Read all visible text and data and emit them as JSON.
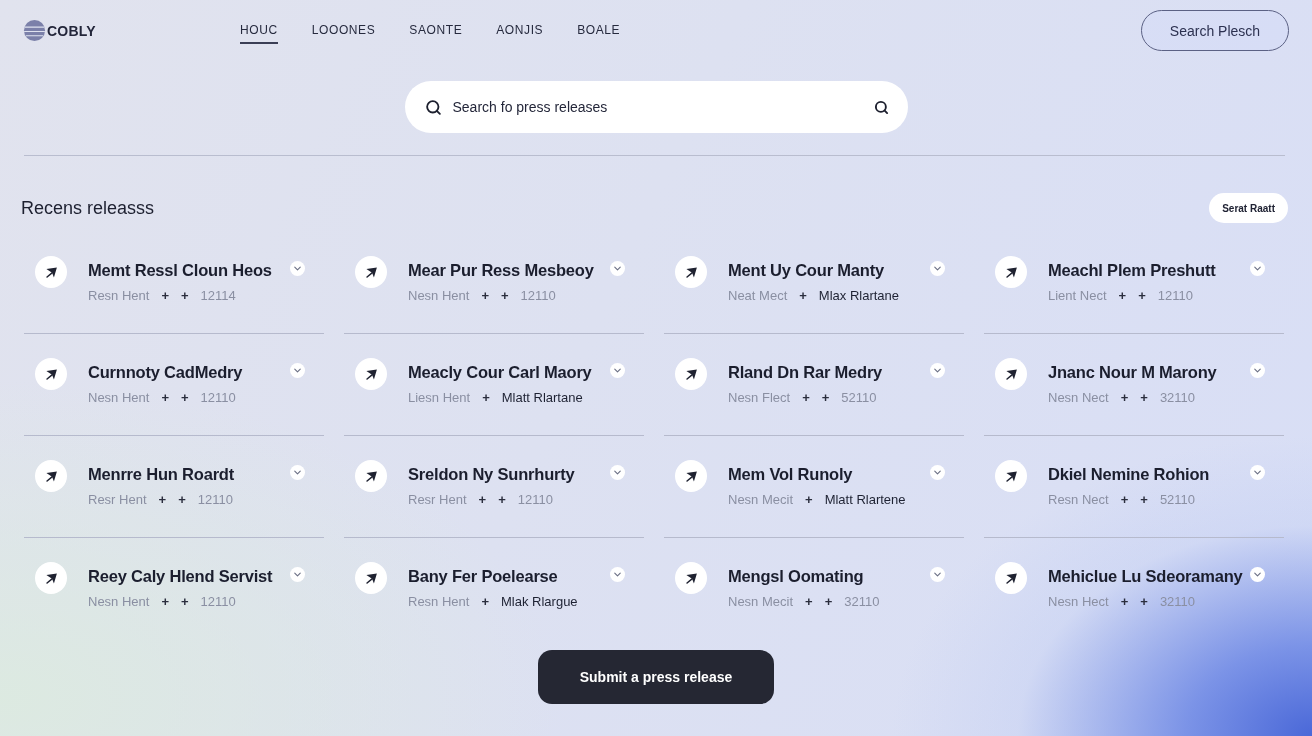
{
  "header": {
    "logo": "COBLY",
    "nav": [
      {
        "label": "HOUC",
        "selected": true
      },
      {
        "label": "LOOONES",
        "selected": false
      },
      {
        "label": "SAONTE",
        "selected": false
      },
      {
        "label": "AONJIS",
        "selected": false
      },
      {
        "label": "BOALE",
        "selected": false
      }
    ],
    "action": "Search Plesch"
  },
  "search": {
    "placeholder": "Search fo press releases"
  },
  "releases": {
    "title": "Recens releasss",
    "action": "Serat Raatt",
    "items": [
      {
        "title": "Memt Ressl Cloun Heos",
        "meta": [
          {
            "kind": "text",
            "text": "Resn Hent"
          },
          {
            "kind": "sep",
            "text": "+"
          },
          {
            "kind": "sep",
            "text": "+"
          },
          {
            "kind": "text",
            "text": "12114"
          }
        ]
      },
      {
        "title": "Mear Pur Ress Mesbeoy",
        "meta": [
          {
            "kind": "text",
            "text": "Nesn Hent"
          },
          {
            "kind": "sep",
            "text": "+"
          },
          {
            "kind": "sep",
            "text": "+"
          },
          {
            "kind": "text",
            "text": "12110"
          }
        ]
      },
      {
        "title": "Ment Uy Cour Manty",
        "meta": [
          {
            "kind": "text",
            "text": "Neat Mect"
          },
          {
            "kind": "sep",
            "text": "+"
          },
          {
            "kind": "highlight",
            "text": "Mlax Rlartane"
          }
        ]
      },
      {
        "title": "Meachl Plem Preshutt",
        "meta": [
          {
            "kind": "text",
            "text": "Lient Nect"
          },
          {
            "kind": "sep",
            "text": "+"
          },
          {
            "kind": "sep",
            "text": "+"
          },
          {
            "kind": "text",
            "text": "12110"
          }
        ]
      },
      {
        "title": "Curnnoty CadMedry",
        "meta": [
          {
            "kind": "text",
            "text": "Nesn Hent"
          },
          {
            "kind": "sep",
            "text": "+"
          },
          {
            "kind": "sep",
            "text": "+"
          },
          {
            "kind": "text",
            "text": "12110"
          }
        ]
      },
      {
        "title": "Meacly Cour Carl Maory",
        "meta": [
          {
            "kind": "text",
            "text": "Liesn Hent"
          },
          {
            "kind": "sep",
            "text": "+"
          },
          {
            "kind": "highlight",
            "text": "Mlatt Rlartane"
          }
        ]
      },
      {
        "title": "Rland Dn Rar Medry",
        "meta": [
          {
            "kind": "text",
            "text": "Nesn Flect"
          },
          {
            "kind": "sep",
            "text": "+"
          },
          {
            "kind": "sep",
            "text": "+"
          },
          {
            "kind": "text",
            "text": "52110"
          }
        ]
      },
      {
        "title": "Jnanc Nour M Marony",
        "meta": [
          {
            "kind": "text",
            "text": "Nesn Nect"
          },
          {
            "kind": "sep",
            "text": "+"
          },
          {
            "kind": "sep",
            "text": "+"
          },
          {
            "kind": "text",
            "text": "32110"
          }
        ]
      },
      {
        "title": "Menrre Hun Roardt",
        "meta": [
          {
            "kind": "text",
            "text": "Resr Hent"
          },
          {
            "kind": "sep",
            "text": "+"
          },
          {
            "kind": "sep",
            "text": "+"
          },
          {
            "kind": "text",
            "text": "12110"
          }
        ]
      },
      {
        "title": "Sreldon Ny Sunrhurty",
        "meta": [
          {
            "kind": "text",
            "text": "Resr Hent"
          },
          {
            "kind": "sep",
            "text": "+"
          },
          {
            "kind": "sep",
            "text": "+"
          },
          {
            "kind": "text",
            "text": "12110"
          }
        ]
      },
      {
        "title": "Mem Vol Runoly",
        "meta": [
          {
            "kind": "text",
            "text": "Nesn Mecit"
          },
          {
            "kind": "sep",
            "text": "+"
          },
          {
            "kind": "highlight",
            "text": "Mlatt Rlartene"
          }
        ]
      },
      {
        "title": "Dkiel Nemine Rohion",
        "meta": [
          {
            "kind": "text",
            "text": "Resn Nect"
          },
          {
            "kind": "sep",
            "text": "+"
          },
          {
            "kind": "sep",
            "text": "+"
          },
          {
            "kind": "text",
            "text": "52110"
          }
        ]
      },
      {
        "title": "Reey Caly Hlend Servist",
        "meta": [
          {
            "kind": "text",
            "text": "Nesn Hent"
          },
          {
            "kind": "sep",
            "text": "+"
          },
          {
            "kind": "sep",
            "text": "+"
          },
          {
            "kind": "text",
            "text": "12110"
          }
        ]
      },
      {
        "title": "Bany Fer Poelearse",
        "meta": [
          {
            "kind": "text",
            "text": "Resn Hent"
          },
          {
            "kind": "sep",
            "text": "+"
          },
          {
            "kind": "highlight",
            "text": "Mlak Rlargue"
          }
        ]
      },
      {
        "title": "Mengsl Oomating",
        "meta": [
          {
            "kind": "text",
            "text": "Nesn Mecit"
          },
          {
            "kind": "sep",
            "text": "+"
          },
          {
            "kind": "sep",
            "text": "+"
          },
          {
            "kind": "text",
            "text": "32110"
          }
        ]
      },
      {
        "title": "Mehiclue Lu Sdeoramany",
        "meta": [
          {
            "kind": "text",
            "text": "Nesn Hect"
          },
          {
            "kind": "sep",
            "text": "+"
          },
          {
            "kind": "sep",
            "text": "+"
          },
          {
            "kind": "text",
            "text": "32110"
          }
        ]
      }
    ]
  },
  "submit": "Submit a press release"
}
